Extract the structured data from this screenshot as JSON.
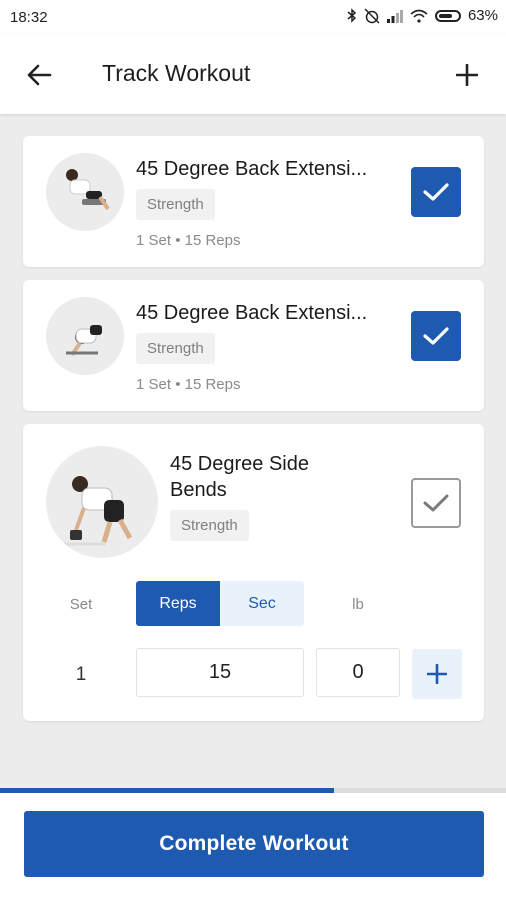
{
  "status_bar": {
    "time": "18:32",
    "battery": "63%",
    "icons": [
      "bluetooth-icon",
      "alarm-off-icon",
      "signal-icon",
      "wifi-icon",
      "battery-icon"
    ]
  },
  "header": {
    "title": "Track Workout",
    "back_icon": "back-arrow-icon",
    "add_icon": "plus-icon"
  },
  "exercises": [
    {
      "name": "45 Degree Back Extensi...",
      "tag": "Strength",
      "summary": "1 Set • 15 Reps",
      "completed": true
    },
    {
      "name": "45 Degree Back Extensi...",
      "tag": "Strength",
      "summary": "1 Set • 15 Reps",
      "completed": true
    },
    {
      "name": "45 Degree Side Bends",
      "tag": "Strength",
      "completed": false,
      "editor": {
        "set_label": "Set",
        "reps_label": "Reps",
        "sec_label": "Sec",
        "unit_label": "lb",
        "active_mode": "Reps",
        "set_number": "1",
        "reps_value": "15",
        "weight_value": "0"
      }
    }
  ],
  "progress": {
    "fraction": 0.66
  },
  "footer": {
    "complete_label": "Complete Workout"
  },
  "colors": {
    "accent": "#1e5ab0",
    "accent_light": "#e9f1fb",
    "background": "#ececec"
  }
}
